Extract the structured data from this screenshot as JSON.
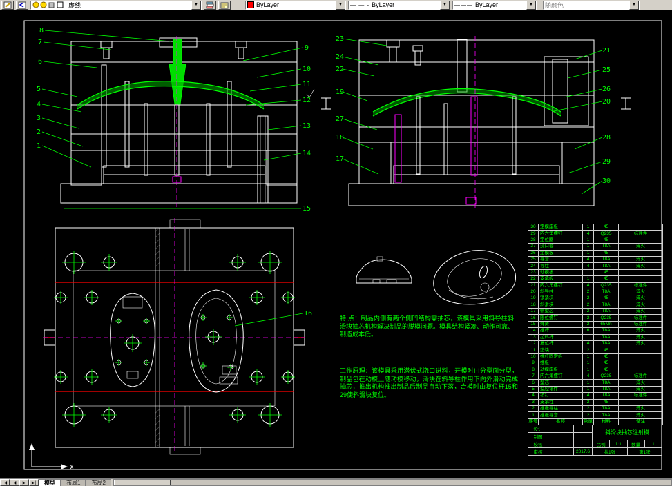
{
  "toolbar": {
    "layer": {
      "value": "虚线"
    },
    "color": {
      "value": "ByLayer"
    },
    "linetype": {
      "value": "ByLayer",
      "preview": "— — -"
    },
    "lineweight": {
      "value": "ByLayer",
      "preview": "———"
    },
    "plot_style": {
      "value": "随颜色"
    }
  },
  "callouts": {
    "v1_left": [
      "8",
      "7",
      "6",
      "5",
      "4",
      "3",
      "2",
      "1"
    ],
    "v1_right": [
      "9",
      "10",
      "11",
      "12",
      "13",
      "14",
      "15"
    ],
    "v2_left": [
      "23",
      "24",
      "22",
      "19",
      "27",
      "18",
      "17"
    ],
    "v2_right": [
      "21",
      "25",
      "26",
      "20",
      "28",
      "29",
      "30"
    ],
    "plan": [
      "16"
    ]
  },
  "notes": {
    "feature": "特  点：制品内侧有两个侧凹结构需抽芯，该模具采用斜导柱斜滑块抽芯机构解决制品的脱模问题。模具结构紧凑、动作可靠、制造成本低。",
    "principle": "工作原理：该模具采用潜伏式浇口进料，开模时Ⅰ-Ⅰ分型面分型，制品包在动模上随动模移动，滑块在斜导柱作用下向外滑动完成抽芯，推出机构推出制品后制品自动下落，合模时由复位杆15和29使斜滑块复位。"
  },
  "bom": {
    "headers": [
      "序号",
      "名称",
      "数量",
      "材料",
      "备注"
    ],
    "rows": [
      [
        "30",
        "定模座板",
        "1",
        "45",
        ""
      ],
      [
        "29",
        "内六角螺钉",
        "4",
        "Q235",
        "标准件"
      ],
      [
        "28",
        "定位圈",
        "1",
        "45",
        ""
      ],
      [
        "27",
        "浇口套",
        "1",
        "T8A",
        "淬火"
      ],
      [
        "26",
        "定模板",
        "1",
        "45",
        ""
      ],
      [
        "25",
        "导套",
        "4",
        "T8A",
        "淬火"
      ],
      [
        "24",
        "导柱",
        "4",
        "T8A",
        "淬火"
      ],
      [
        "23",
        "动模板",
        "1",
        "45",
        ""
      ],
      [
        "22",
        "支承板",
        "1",
        "45",
        ""
      ],
      [
        "21",
        "内六角螺钉",
        "4",
        "Q235",
        "标准件"
      ],
      [
        "20",
        "斜导柱",
        "2",
        "T8A",
        "淬火"
      ],
      [
        "19",
        "锁紧块",
        "2",
        "45",
        "淬火"
      ],
      [
        "18",
        "斜滑块",
        "2",
        "T8A",
        "淬火"
      ],
      [
        "17",
        "侧型芯",
        "2",
        "T8A",
        "淬火"
      ],
      [
        "16",
        "限位螺钉",
        "2",
        "Q235",
        "标准件"
      ],
      [
        "15",
        "弹簧",
        "2",
        "65Mn",
        "标准件"
      ],
      [
        "14",
        "推杆",
        "6",
        "T8A",
        "淬火"
      ],
      [
        "13",
        "拉料杆",
        "1",
        "T8A",
        "淬火"
      ],
      [
        "12",
        "复位杆",
        "4",
        "T8A",
        "淬火"
      ],
      [
        "11",
        "垫块",
        "2",
        "45",
        ""
      ],
      [
        "10",
        "推杆固定板",
        "1",
        "45",
        ""
      ],
      [
        "9",
        "推板",
        "1",
        "45",
        ""
      ],
      [
        "8",
        "动模座板",
        "1",
        "45",
        ""
      ],
      [
        "7",
        "内六角螺钉",
        "4",
        "Q235",
        "标准件"
      ],
      [
        "6",
        "型芯",
        "1",
        "T8A",
        "淬火"
      ],
      [
        "5",
        "型腔镶件",
        "1",
        "T8A",
        "淬火"
      ],
      [
        "4",
        "销钉",
        "4",
        "T8A",
        "标准件"
      ],
      [
        "3",
        "支承柱",
        "2",
        "45",
        ""
      ],
      [
        "2",
        "推板导柱",
        "2",
        "T8A",
        "淬火"
      ],
      [
        "1",
        "推板导套",
        "2",
        "T8A",
        "淬火"
      ]
    ]
  },
  "title_block": {
    "roles": [
      [
        "设计",
        ""
      ],
      [
        "制图",
        ""
      ],
      [
        "校核",
        ""
      ],
      [
        "审核",
        "2017.6"
      ]
    ],
    "title": "斜滑块抽芯注射模",
    "scale_label": "比例",
    "scale": "1:1",
    "qty_label": "数量",
    "qty": "1",
    "sheet": "共1张",
    "sheet_no": "第1张"
  },
  "ucs": {
    "x_label": "X"
  },
  "tabs": {
    "nav": [
      "|◀",
      "◀",
      "▶",
      "▶|"
    ],
    "items": [
      "模型",
      "布局1",
      "布局2"
    ]
  }
}
